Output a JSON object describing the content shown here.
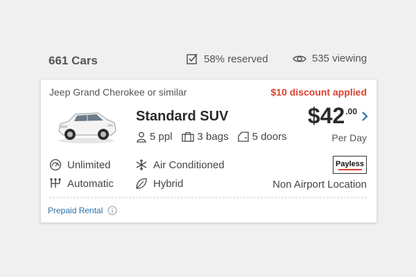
{
  "summary": {
    "car_count": "661 Cars",
    "reserved": "58% reserved",
    "viewing": "535 viewing"
  },
  "listing": {
    "similar_text": "Jeep Grand Cherokee or similar",
    "discount_text": "$10 discount applied",
    "car_type": "Standard SUV",
    "specs": {
      "people": "5 ppl",
      "bags": "3 bags",
      "doors": "5 doors"
    },
    "price": {
      "main": "$42",
      "cents": ".00",
      "period": "Per Day"
    },
    "features": {
      "mileage": "Unlimited",
      "ac": "Air Conditioned",
      "transmission": "Automatic",
      "fuel": "Hybrid"
    },
    "vendor": "Payless",
    "location": "Non Airport Location",
    "rental_type": "Prepaid Rental"
  },
  "colors": {
    "discount": "#d9412e",
    "link": "#2a6fa5",
    "background": "#f0f0f0"
  }
}
